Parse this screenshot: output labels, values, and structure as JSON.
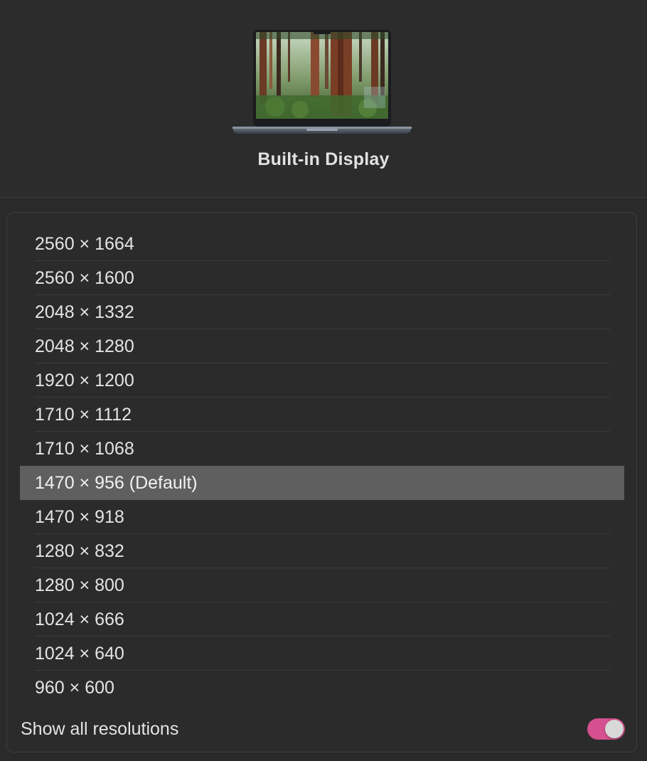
{
  "display": {
    "title": "Built-in Display"
  },
  "resolutions": [
    {
      "label": "2560 × 1664",
      "selected": false
    },
    {
      "label": "2560 × 1600",
      "selected": false
    },
    {
      "label": "2048 × 1332",
      "selected": false
    },
    {
      "label": "2048 × 1280",
      "selected": false
    },
    {
      "label": "1920 × 1200",
      "selected": false
    },
    {
      "label": "1710 × 1112",
      "selected": false
    },
    {
      "label": "1710 × 1068",
      "selected": false
    },
    {
      "label": "1470 × 956 (Default)",
      "selected": true
    },
    {
      "label": "1470 × 918",
      "selected": false
    },
    {
      "label": "1280 × 832",
      "selected": false
    },
    {
      "label": "1280 × 800",
      "selected": false
    },
    {
      "label": "1024 × 666",
      "selected": false
    },
    {
      "label": "1024 × 640",
      "selected": false
    },
    {
      "label": "960 × 600",
      "selected": false
    }
  ],
  "show_all": {
    "label": "Show all resolutions",
    "enabled": true
  },
  "colors": {
    "toggle_on": "#d4508f",
    "selected_row": "#5f5f5f",
    "background": "#2a2a2a"
  },
  "icons": {
    "display": "macbook-laptop-icon"
  }
}
